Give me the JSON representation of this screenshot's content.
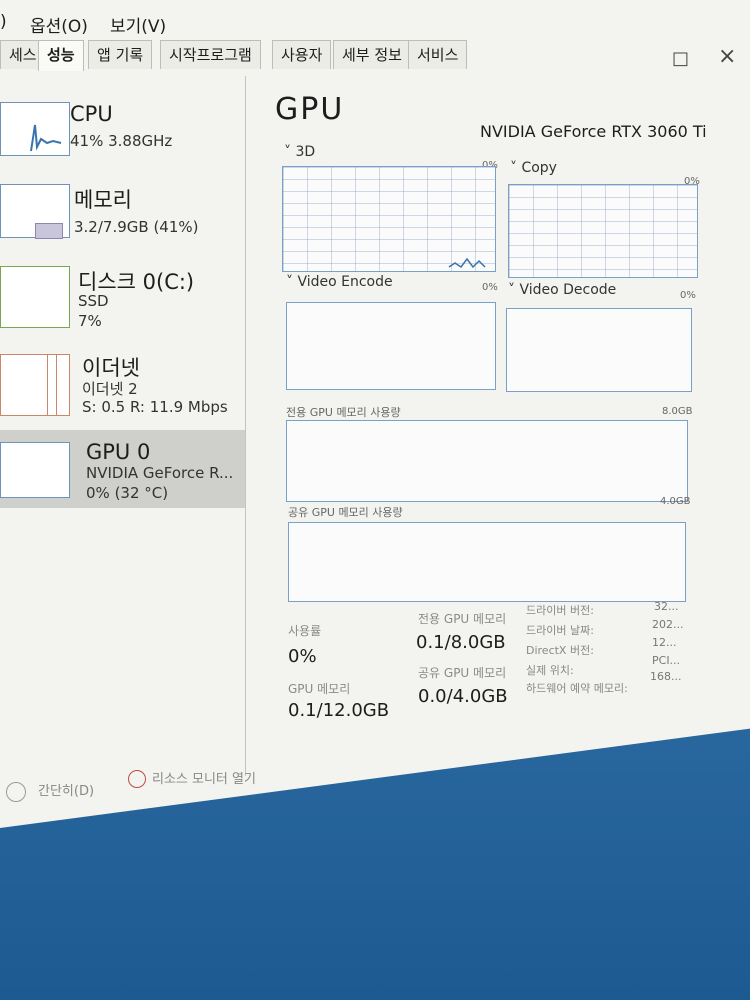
{
  "menu": {
    "prev_fragment": ")",
    "options": "옵션(O)",
    "view": "보기(V)"
  },
  "window_controls": {
    "maximize": "□",
    "close": "×"
  },
  "tabs": [
    {
      "label": "세스"
    },
    {
      "label": "성능"
    },
    {
      "label": "앱 기록"
    },
    {
      "label": "시작프로그램"
    },
    {
      "label": "사용자"
    },
    {
      "label": "세부 정보"
    },
    {
      "label": "서비스"
    }
  ],
  "sidebar": {
    "cpu": {
      "title": "CPU",
      "sub1": "41% 3.88GHz"
    },
    "memory": {
      "title": "메모리",
      "sub1": "3.2/7.9GB (41%)"
    },
    "disk": {
      "title": "디스크 0(C:)",
      "sub1": "SSD",
      "sub2": "7%"
    },
    "ethernet": {
      "title": "이더넷",
      "sub1": "이더넷 2",
      "sub2": "S: 0.5 R: 11.9 Mbps"
    },
    "gpu": {
      "title": "GPU 0",
      "sub1": "NVIDIA GeForce R...",
      "sub2": "0% (32 °C)"
    }
  },
  "main": {
    "title": "GPU",
    "device_name": "NVIDIA GeForce RTX 3060 Ti",
    "engines": [
      {
        "label": "˅ 3D",
        "value": "0%"
      },
      {
        "label": "˅ Copy",
        "value": "0%"
      },
      {
        "label": "˅ Video Encode",
        "value": "0%"
      },
      {
        "label": "˅ Video Decode",
        "value": "0%"
      }
    ],
    "dedicated_mem_label": "전용 GPU 메모리 사용량",
    "dedicated_mem_max": "8.0GB",
    "shared_mem_label": "공유 GPU 메모리 사용량",
    "shared_mem_max": "4.0GB",
    "stats": {
      "usage_label": "사용률",
      "usage_value": "0%",
      "dedicated_label": "전용 GPU 메모리",
      "dedicated_value": "0.1/8.0GB",
      "gpu_mem_label": "GPU 메모리",
      "gpu_mem_value": "0.1/12.0GB",
      "shared_label": "공유 GPU 메모리",
      "shared_value": "0.0/4.0GB"
    },
    "info": [
      {
        "label": "드라이버 버전:",
        "value": "32..."
      },
      {
        "label": "드라이버 날짜:",
        "value": "202..."
      },
      {
        "label": "DirectX 버전:",
        "value": "12..."
      },
      {
        "label": "실제 위치:",
        "value": "PCI..."
      },
      {
        "label": "하드웨어 예약 메모리:",
        "value": "168..."
      }
    ]
  },
  "footer": {
    "brief": "간단히(D)",
    "resource_monitor": "리소스 모니터 열기"
  }
}
